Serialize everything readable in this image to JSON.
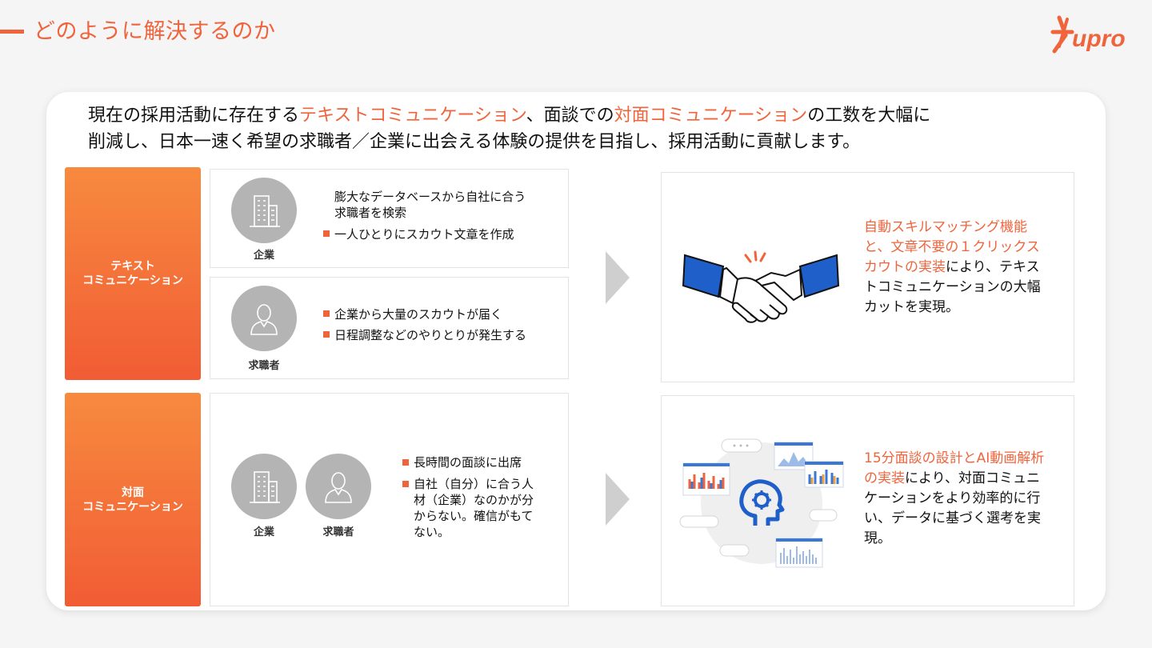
{
  "header": {
    "title": "どのように解決するのか",
    "logo_text": "Hupro"
  },
  "lead": {
    "part1": "現在の採用活動に存在する",
    "hl1": "テキストコミュニケーション",
    "part2": "、面談での",
    "hl2": "対面コミュニケーション",
    "part3": "の工数を大幅に",
    "line2": "削減し、日本一速く希望の求職者／企業に出会える体験の提供を目指し、採用活動に貢献します。"
  },
  "text_comm": {
    "label_line1": "テキスト",
    "label_line2": "コミュニケーション",
    "company": {
      "label": "企業",
      "item1_line1": "膨大なデータベースから自社に合う",
      "item1_line2": "求職者を検索",
      "item2": "一人ひとりにスカウト文章を作成"
    },
    "seeker": {
      "label": "求職者",
      "item1": "企業から大量のスカウトが届く",
      "item2": "日程調整などのやりとりが発生する"
    },
    "solution": {
      "hl_line1": "自動スキルマッチング機能",
      "hl_line2": "と、文章不要の１クリックス",
      "hl_line3": "カウトの実装",
      "rest_line3": "により、テキス",
      "line4": "トコミュニケーションの大幅",
      "line5": "カットを実現。"
    }
  },
  "face_comm": {
    "label_line1": "対面",
    "label_line2": "コミュニケーション",
    "company_label": "企業",
    "seeker_label": "求職者",
    "item1": "長時間の面談に出席",
    "item2_line1": "自社（自分）に合う人",
    "item2_line2": "材（企業）なのかが分",
    "item2_line3": "からない。確信がもて",
    "item2_line4": "ない。",
    "solution": {
      "hl_line1": "15分面談の設計とAI動画解析",
      "hl_line2": "の実装",
      "rest_line2": "により、対面コミュニ",
      "line3": "ケーションをより効率的に行",
      "line4": "い、データに基づく選考を実",
      "line5": "現。"
    }
  },
  "colors": {
    "accent": "#f0643c",
    "gradient_top": "#f78a3e",
    "gradient_bottom": "#f15c35",
    "icon_gray": "#b4b4b4",
    "handshake_blue": "#1f5fc9"
  }
}
